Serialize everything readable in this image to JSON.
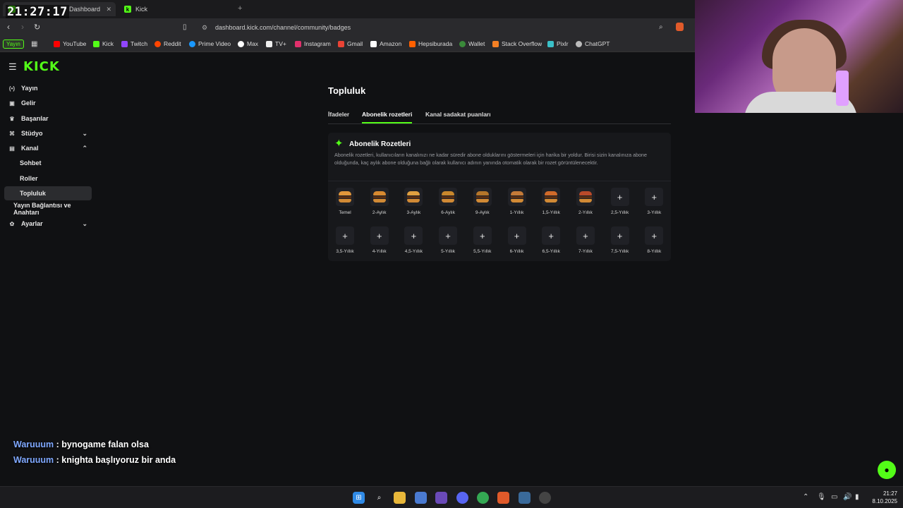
{
  "overlay": {
    "clock": "21:27:17"
  },
  "browser": {
    "tabs": [
      {
        "label": "Dashboard",
        "active": true
      },
      {
        "label": "Kick",
        "active": false
      }
    ],
    "new_tab": "+",
    "url": "dashboard.kick.com/channel/community/badges",
    "yayin_chip": "Yayın",
    "bookmarks": [
      "YouTube",
      "Kick",
      "Twitch",
      "Reddit",
      "Prime Video",
      "Max",
      "TV+",
      "Instagram",
      "Gmail",
      "Amazon",
      "Hepsiburada",
      "Wallet",
      "Stack Overflow",
      "Pixlr",
      "ChatGPT"
    ]
  },
  "app": {
    "logo": "KICK",
    "sidebar": {
      "items": [
        {
          "label": "Yayın"
        },
        {
          "label": "Gelir"
        },
        {
          "label": "Başarılar"
        },
        {
          "label": "Stüdyo"
        },
        {
          "label": "Kanal"
        },
        {
          "label": "Sohbet"
        },
        {
          "label": "Roller"
        },
        {
          "label": "Topluluk"
        },
        {
          "label": "Yayın Bağlantısı ve Anahtarı"
        },
        {
          "label": "Ayarlar"
        }
      ]
    },
    "page_title": "Topluluk",
    "tabs": [
      "İfadeler",
      "Abonelik rozetleri",
      "Kanal sadakat puanları"
    ],
    "panel": {
      "title": "Abonelik Rozetleri",
      "description": "Abonelik rozetleri, kullanıcıların kanalınızı ne kadar süredir abone olduklarını göstermeleri için harika bir yoldur. Birisi sizin kanalınıza abone olduğunda, kaç aylık abone olduğuna bağlı olarak kullanıcı adının yanında otomatik olarak bir rozet görüntülenecektir.",
      "badges_row1": [
        "Temel",
        "2-Aylık",
        "3-Aylık",
        "6-Aylık",
        "9-Aylık",
        "1-Yıllık",
        "1,5-Yıllık",
        "2-Yıllık",
        "2,5-Yıllık",
        "3-Yıllık"
      ],
      "badges_row2": [
        "3,5-Yıllık",
        "4-Yıllık",
        "4,5-Yıllık",
        "5-Yıllık",
        "5,5-Yıllık",
        "6-Yıllık",
        "6,5-Yıllık",
        "7-Yıllık",
        "7,5-Yıllık",
        "8-Yıllık"
      ],
      "add_symbol": "+"
    }
  },
  "chat_overlay": [
    {
      "user": "Waruuum",
      "sep": " : ",
      "message": "bynogame falan olsa"
    },
    {
      "user": "Waruuum",
      "sep": " : ",
      "message": "knighta başlıyoruz bir anda"
    }
  ],
  "taskbar": {
    "time": "21:27",
    "date": "8.10.2025"
  },
  "colors": {
    "accent": "#53fc18",
    "background": "#101113",
    "panel": "#17181b"
  }
}
